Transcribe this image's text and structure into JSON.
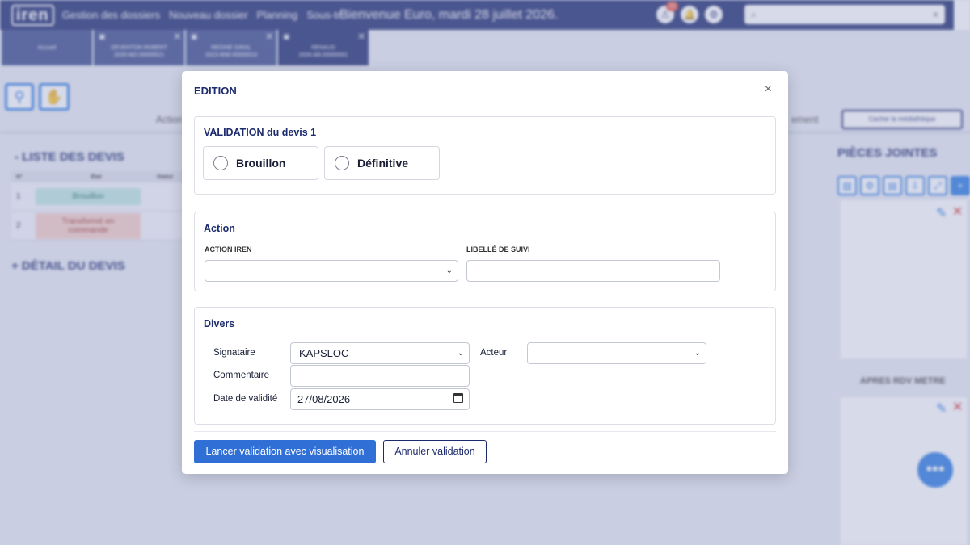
{
  "app": {
    "logo": "iren",
    "nav": [
      "Gestion des dossiers",
      "Nouveau dossier",
      "Planning",
      "Sous-tr"
    ],
    "welcome": "Bienvenue Euro, mardi 28 juillet 2026.",
    "notification_count": "10",
    "search_icon": "⌕",
    "search_clear": "×"
  },
  "tabs": [
    {
      "label": "Accueil",
      "sub": "",
      "closable": false
    },
    {
      "label": "DEVENTON ROBERT",
      "sub": "2026-MD-00009521",
      "closable": true
    },
    {
      "label": "REGINE GIRAL",
      "sub": "2023-WW-00000015",
      "closable": true
    },
    {
      "label": "RENAUD",
      "sub": "2026-AB-00000001",
      "closable": true
    }
  ],
  "subnav": {
    "left": "Action",
    "right": "ement",
    "media_button": "Cacher la médiathèque"
  },
  "devis_list": {
    "title": "- LISTE DES DEVIS",
    "columns": [
      "N°",
      "État",
      "Statut"
    ],
    "rows": [
      {
        "n": "1",
        "etat": "Brouillon",
        "style": "green"
      },
      {
        "n": "2",
        "etat": "Transformé en commande",
        "style": "red"
      }
    ],
    "detail_title": "+ DÉTAIL DU DEVIS"
  },
  "pieces_jointes": {
    "title": "PIÈCES JOINTES",
    "caption": "APRES RDV METRE"
  },
  "modal": {
    "title": "EDITION",
    "close": "×",
    "validation": {
      "title": "VALIDATION du devis 1",
      "options": [
        "Brouillon",
        "Définitive"
      ]
    },
    "action": {
      "title": "Action",
      "action_iren_label": "ACTION IREN",
      "action_iren_value": "",
      "libelle_label": "LIBELLÉ DE SUIVI",
      "libelle_value": ""
    },
    "divers": {
      "title": "Divers",
      "signataire_label": "Signataire",
      "signataire_value": "KAPSLOC",
      "acteur_label": "Acteur",
      "acteur_value": "",
      "commentaire_label": "Commentaire",
      "commentaire_value": "",
      "date_label": "Date de validité",
      "date_value": "27/08/2026"
    },
    "buttons": {
      "primary": "Lancer validation avec visualisation",
      "secondary": "Annuler validation"
    }
  },
  "colors": {
    "brand": "#1c2a6e",
    "primary_button": "#2f6fd6",
    "overlay": "#969ec4"
  }
}
